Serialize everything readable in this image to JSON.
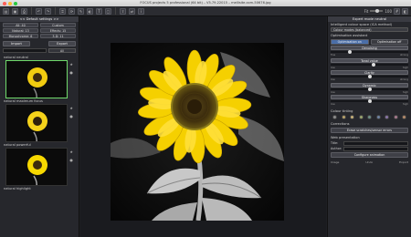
{
  "window": {
    "title": "FOCUS projects 5 professional (64 bit) – V5.79.22015 – mellisite.com-50676.jpg"
  },
  "toolbar": {
    "icons": [
      "open-icon",
      "save-icon",
      "print-icon",
      "undo-icon",
      "redo-icon",
      "crop-icon",
      "rotate-icon",
      "retouch-icon",
      "mask-icon",
      "text-icon",
      "frame-icon",
      "export-icon",
      "share-icon",
      "info-icon",
      "grid-icon",
      "compare-icon"
    ],
    "zoom_label": "Fit",
    "zoom_value": "100"
  },
  "left_panel": {
    "title": "<< Default settings >>",
    "presets": [
      "All: 40",
      "Custom",
      "Natural: 13",
      "Effects: 15",
      "Monochrome: 6",
      "3-D: 11"
    ],
    "import_label": "Import",
    "export_label": "Export",
    "filter_select": "All",
    "thumbnails": [
      {
        "label": "natural neutral",
        "selected": true
      },
      {
        "label": "natural maximum focus",
        "selected": false
      },
      {
        "label": "natural powerful",
        "selected": false
      },
      {
        "label": "natural highlight",
        "selected": false
      }
    ]
  },
  "right_panel": {
    "title": "Expert mode neutral",
    "colour_space_label": "Intelligent colour space (ICA method)",
    "colour_space_value": "Colour modes (balanced)",
    "optimisation_label": "Optimisation assistant",
    "optimisation_on": "Optimisation on",
    "optimisation_off": "Optimisation off",
    "sliders": [
      {
        "label": "Denoising",
        "left": "fine",
        "right": "strong",
        "value": 0.25
      },
      {
        "label": "Tonal value",
        "left": "low",
        "right": "high",
        "value": 0.55
      },
      {
        "label": "Clarity",
        "left": "low",
        "right": "strong",
        "value": 0.5
      },
      {
        "label": "Dynamic",
        "left": "low",
        "right": "high",
        "value": 0.5
      },
      {
        "label": "Sharpness",
        "left": "low",
        "right": "high",
        "value": 0.5
      }
    ],
    "colour_tinting_label": "Colour tinting",
    "tints": [
      "#8c8c8c",
      "#b8a36a",
      "#c8b27a",
      "#9aa56f",
      "#6e8f86",
      "#6f83a3",
      "#8a76a8",
      "#a87a8f",
      "#b58a6a"
    ],
    "corrections_label": "Corrections",
    "erase_button": "Erase scratches/sensor errors",
    "web_label": "Web presentation",
    "title_field": "Title:",
    "author_field": "Author:",
    "animation_button": "Configure animation",
    "footer_left": "Image",
    "footer_mid": "Undo",
    "footer_right": "Export"
  }
}
